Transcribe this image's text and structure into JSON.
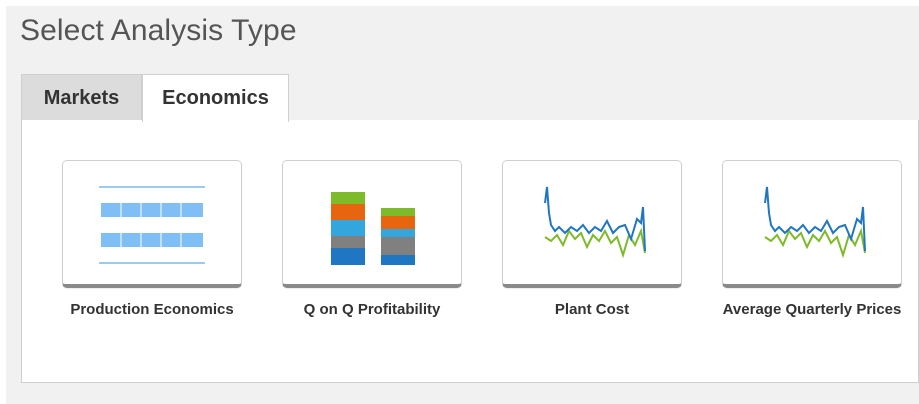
{
  "page": {
    "title": "Select Analysis Type"
  },
  "tabs": [
    {
      "label": "Markets",
      "active": false
    },
    {
      "label": "Economics",
      "active": true
    }
  ],
  "cards": [
    {
      "label": "Production Economics",
      "icon": "table-icon"
    },
    {
      "label": "Q on Q Profitability",
      "icon": "stacked-bar-icon"
    },
    {
      "label": "Plant Cost",
      "icon": "line-chart-icon"
    },
    {
      "label": "Average Quarterly Prices",
      "icon": "line-chart-icon"
    }
  ],
  "colors": {
    "blue": "#1f76c2",
    "light_blue": "#33a6de",
    "orange": "#e8650f",
    "green": "#7dbb2a",
    "gray": "#808080",
    "table_blue": "#7fbff5"
  }
}
